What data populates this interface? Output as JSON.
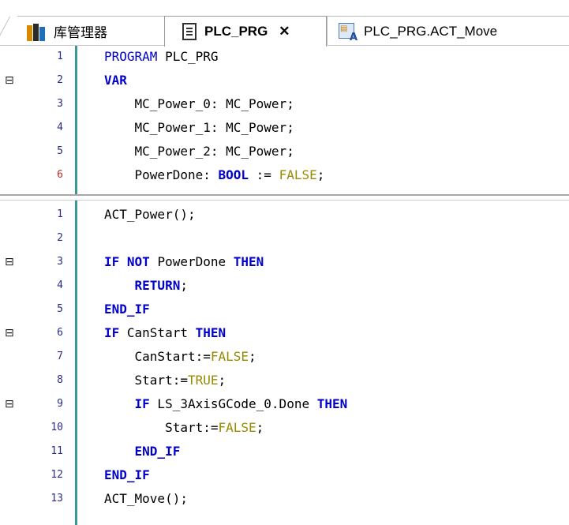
{
  "tabs": [
    {
      "label": "库管理器",
      "icon": "library-icon",
      "active": false
    },
    {
      "label": "PLC_PRG",
      "icon": "document-icon",
      "active": true,
      "close": "✕"
    },
    {
      "label": "PLC_PRG.ACT_Move",
      "icon": "action-icon",
      "active": false
    }
  ],
  "declaration": {
    "lines": [
      {
        "n": "1",
        "tokens": [
          {
            "t": "PROGRAM",
            "c": "kw-plain"
          },
          {
            "t": " PLC_PRG",
            "c": ""
          }
        ]
      },
      {
        "n": "2",
        "fold": "⊟",
        "tokens": [
          {
            "t": "VAR",
            "c": "kw"
          }
        ]
      },
      {
        "n": "3",
        "tokens": [
          {
            "t": "    MC_Power_0: MC_Power;",
            "c": ""
          }
        ]
      },
      {
        "n": "4",
        "tokens": [
          {
            "t": "    MC_Power_1: MC_Power;",
            "c": ""
          }
        ]
      },
      {
        "n": "5",
        "tokens": [
          {
            "t": "    MC_Power_2: MC_Power;",
            "c": ""
          }
        ]
      },
      {
        "n": "6",
        "red": true,
        "tokens": [
          {
            "t": "    PowerDone: ",
            "c": ""
          },
          {
            "t": "BOOL",
            "c": "kw"
          },
          {
            "t": " := ",
            "c": ""
          },
          {
            "t": "FALSE",
            "c": "lit"
          },
          {
            "t": ";",
            "c": ""
          }
        ]
      }
    ]
  },
  "implementation": {
    "lines": [
      {
        "n": "1",
        "tokens": [
          {
            "t": "ACT_Power();",
            "c": ""
          }
        ]
      },
      {
        "n": "2",
        "tokens": []
      },
      {
        "n": "3",
        "fold": "⊟",
        "tokens": [
          {
            "t": "IF",
            "c": "kw"
          },
          {
            "t": " ",
            "c": ""
          },
          {
            "t": "NOT",
            "c": "kw"
          },
          {
            "t": " PowerDone ",
            "c": ""
          },
          {
            "t": "THEN",
            "c": "kw"
          }
        ]
      },
      {
        "n": "4",
        "tokens": [
          {
            "t": "    ",
            "c": ""
          },
          {
            "t": "RETURN",
            "c": "kw"
          },
          {
            "t": ";",
            "c": ""
          }
        ]
      },
      {
        "n": "5",
        "tokens": [
          {
            "t": "END_IF",
            "c": "kw"
          }
        ]
      },
      {
        "n": "6",
        "fold": "⊟",
        "tokens": [
          {
            "t": "IF",
            "c": "kw"
          },
          {
            "t": " CanStart ",
            "c": ""
          },
          {
            "t": "THEN",
            "c": "kw"
          }
        ]
      },
      {
        "n": "7",
        "tokens": [
          {
            "t": "    CanStart:=",
            "c": ""
          },
          {
            "t": "FALSE",
            "c": "lit"
          },
          {
            "t": ";",
            "c": ""
          }
        ]
      },
      {
        "n": "8",
        "tokens": [
          {
            "t": "    Start:=",
            "c": ""
          },
          {
            "t": "TRUE",
            "c": "lit"
          },
          {
            "t": ";",
            "c": ""
          }
        ]
      },
      {
        "n": "9",
        "fold": "⊟",
        "tokens": [
          {
            "t": "    ",
            "c": ""
          },
          {
            "t": "IF",
            "c": "kw"
          },
          {
            "t": " LS_3AxisGCode_0.Done ",
            "c": ""
          },
          {
            "t": "THEN",
            "c": "kw"
          }
        ]
      },
      {
        "n": "10",
        "tokens": [
          {
            "t": "        Start:=",
            "c": ""
          },
          {
            "t": "FALSE",
            "c": "lit"
          },
          {
            "t": ";",
            "c": ""
          }
        ]
      },
      {
        "n": "11",
        "tokens": [
          {
            "t": "    ",
            "c": ""
          },
          {
            "t": "END_IF",
            "c": "kw"
          }
        ]
      },
      {
        "n": "12",
        "tokens": [
          {
            "t": "END_IF",
            "c": "kw"
          }
        ]
      },
      {
        "n": "13",
        "tokens": [
          {
            "t": "ACT_Move();",
            "c": ""
          }
        ]
      }
    ]
  },
  "colors": {
    "keyword": "#0000c8",
    "literal": "#9a8a00",
    "line_number": "#2a2a8a",
    "line_number_error": "#c0271f",
    "gutter_bar": "#3a9a92"
  }
}
